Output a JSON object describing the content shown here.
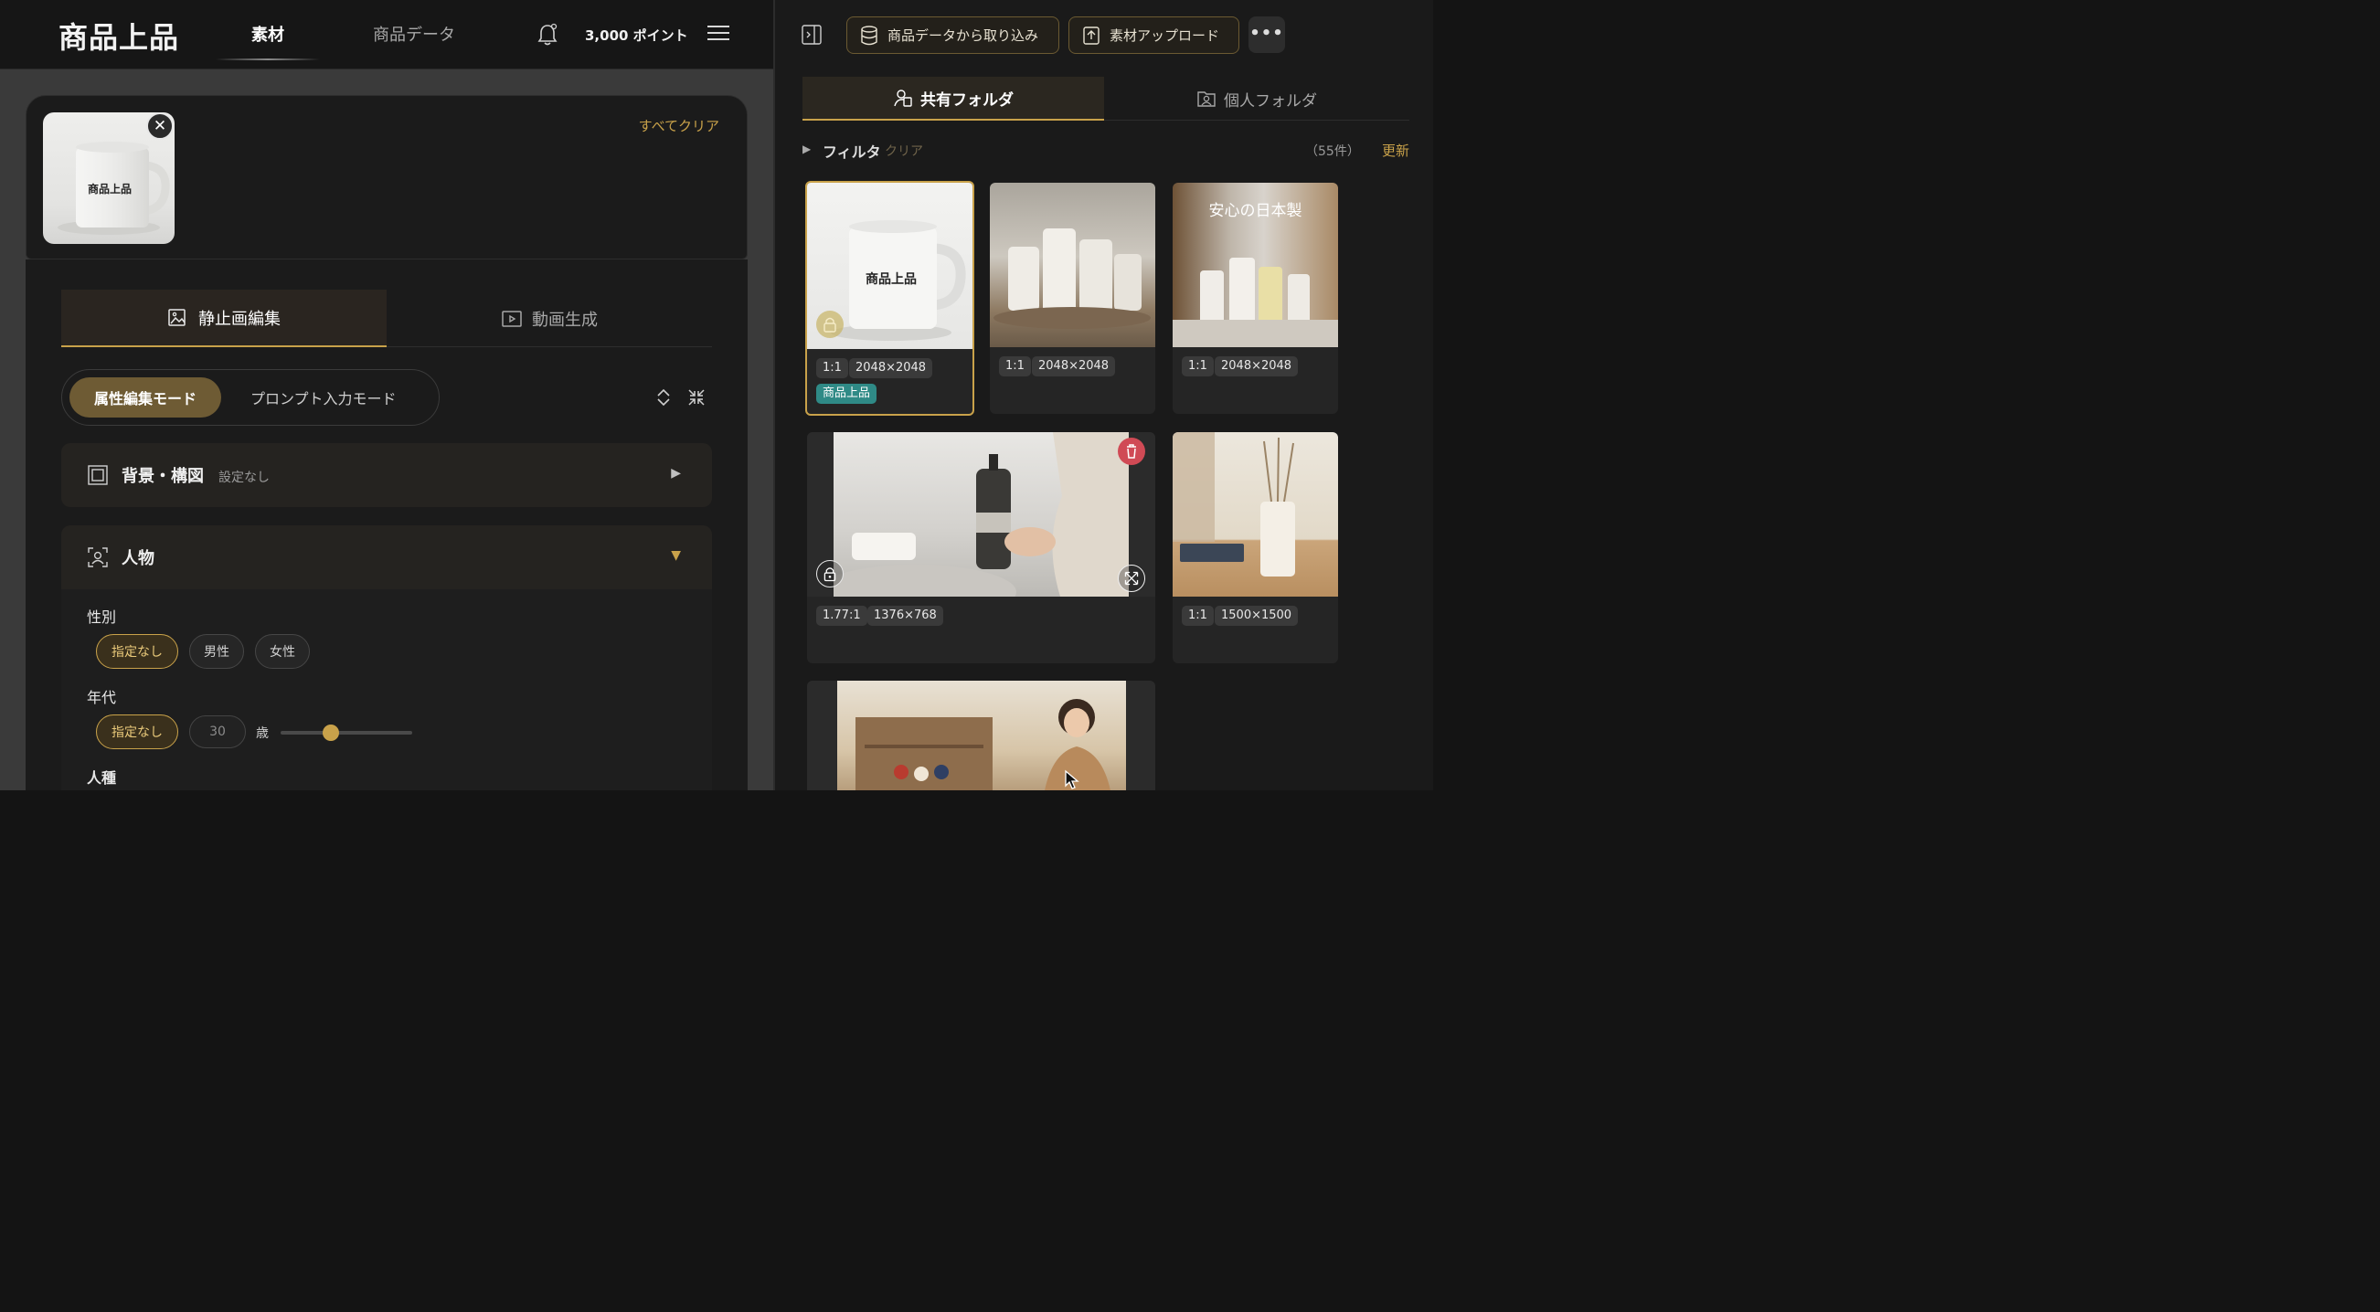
{
  "app": {
    "logo": "商品上品",
    "nav": {
      "active": "素材",
      "second": "商品データ"
    },
    "points": "3,000 ポイント"
  },
  "upload": {
    "thumbnail_text": "商品上品",
    "clear_all": "すべてクリア"
  },
  "editor": {
    "tabs": {
      "still": "静止画編集",
      "video": "動画生成"
    },
    "modes": {
      "attribute": "属性編集モード",
      "prompt": "プロンプト入力モード"
    },
    "sections": {
      "background": {
        "title": "背景・構図",
        "status": "設定なし"
      },
      "person": {
        "title": "人物"
      }
    },
    "gender": {
      "label": "性別",
      "options": [
        "指定なし",
        "男性",
        "女性"
      ],
      "selected": "指定なし"
    },
    "age": {
      "label": "年代",
      "unset": "指定なし",
      "placeholder": "30",
      "unit": "歳",
      "slider_fraction": 0.38
    },
    "race": {
      "label": "人種"
    }
  },
  "library": {
    "actions": {
      "import": "商品データから取り込み",
      "upload": "素材アップロード",
      "more": "•••"
    },
    "folders": {
      "shared": "共有フォルダ",
      "personal": "個人フォルダ"
    },
    "filter": {
      "label": "フィルタ",
      "clear": "クリア",
      "count": "（55件）",
      "refresh": "更新"
    },
    "items": [
      {
        "ratio": "1:1",
        "size": "2048×2048",
        "tag": "商品上品",
        "image_text": "商品上品"
      },
      {
        "ratio": "1:1",
        "size": "2048×2048"
      },
      {
        "ratio": "1:1",
        "size": "2048×2048",
        "image_text": "安心の日本製"
      },
      {
        "ratio": "1.77:1",
        "size": "1376×768"
      },
      {
        "ratio": "1:1",
        "size": "1500×1500"
      }
    ]
  },
  "colors": {
    "accent": "#c9a24a",
    "teal": "#2f8a86",
    "danger": "#d04a55"
  }
}
